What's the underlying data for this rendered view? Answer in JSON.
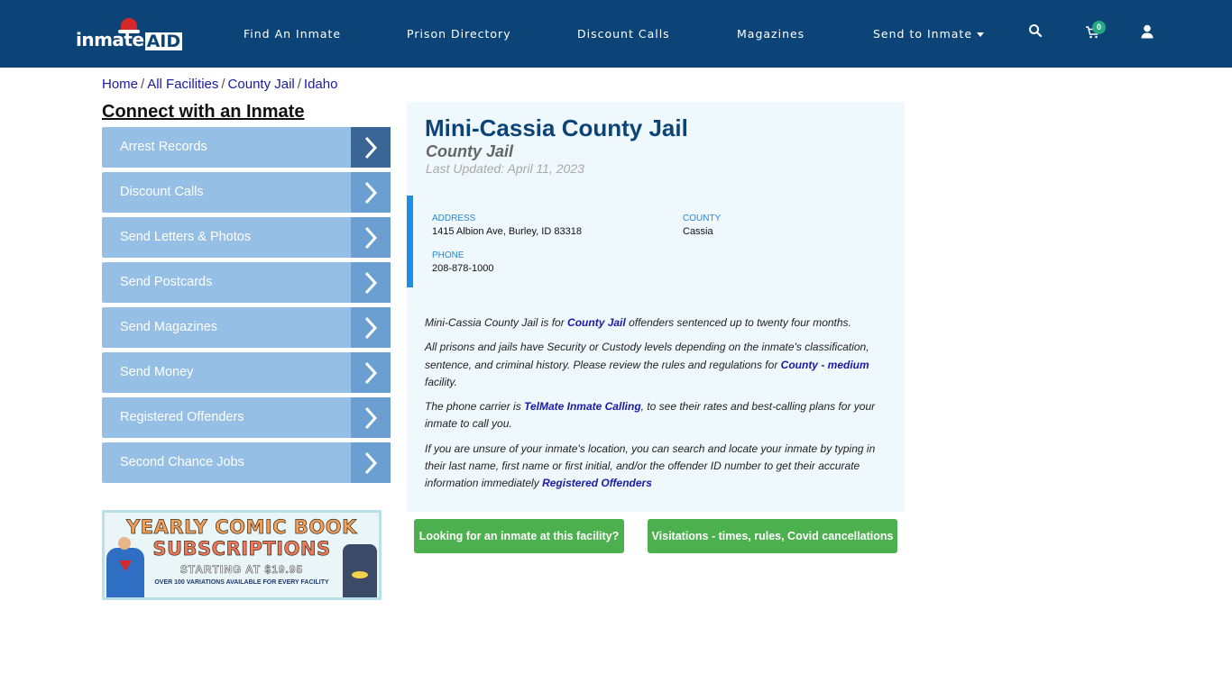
{
  "header": {
    "logo_text_main": "inmate",
    "logo_text_accent": "AID",
    "nav": [
      {
        "label": "Find An Inmate"
      },
      {
        "label": "Prison Directory"
      },
      {
        "label": "Discount Calls"
      },
      {
        "label": "Magazines"
      },
      {
        "label": "Send to Inmate"
      }
    ],
    "icons": [
      "search-icon",
      "cart-icon",
      "user-icon"
    ],
    "cart_count": "0"
  },
  "breadcrumb": [
    {
      "label": "Home"
    },
    {
      "label": "All Facilities"
    },
    {
      "label": "County Jail"
    },
    {
      "label": "Idaho"
    }
  ],
  "sidebar": {
    "title": "Connect with an Inmate",
    "items": [
      {
        "label": "Arrest Records"
      },
      {
        "label": "Discount Calls"
      },
      {
        "label": "Send Letters & Photos"
      },
      {
        "label": "Send Postcards"
      },
      {
        "label": "Send Magazines"
      },
      {
        "label": "Send Money"
      },
      {
        "label": "Registered Offenders"
      },
      {
        "label": "Second Chance Jobs"
      }
    ]
  },
  "ad": {
    "line1": "YEARLY COMIC BOOK",
    "line2": "SUBSCRIPTIONS",
    "line3": "STARTING AT $19.95",
    "line4": "OVER 100 VARIATIONS AVAILABLE FOR EVERY FACILITY"
  },
  "facility": {
    "name": "Mini-Cassia County Jail",
    "type": "County Jail",
    "last_updated": "Last Updated: April 11, 2023",
    "address_label": "ADDRESS",
    "address": "1415 Albion Ave, Burley, ID 83318",
    "county_label": "COUNTY",
    "county": "Cassia",
    "phone_label": "PHONE",
    "phone": "208-878-1000"
  },
  "description": {
    "p1_pre": "Mini-Cassia County Jail is for ",
    "p1_link": "County Jail",
    "p1_post": " offenders sentenced up to twenty four months.",
    "p2_pre": "All prisons and jails have Security or Custody levels depending on the inmate's classification, sentence, and criminal history. Please review the rules and regulations for ",
    "p2_link": "County - medium",
    "p2_post": " facility.",
    "p3_pre": "The phone carrier is ",
    "p3_link": "TelMate Inmate Calling",
    "p3_post": ", to see their rates and best-calling plans for your inmate to call you.",
    "p4_pre": "If you are unsure of your inmate's location, you can search and locate your inmate by typing in their last name, first name or first initial, and/or the offender ID number to get their accurate information immediately ",
    "p4_link": "Registered Offenders"
  },
  "buttons": {
    "find_inmate": "Looking for an inmate at this facility?",
    "visitations": "Visitations - times, rules, Covid cancellations"
  },
  "colors": {
    "header_bg": "#0c4477",
    "sidebar_item": "#96bfe6",
    "sidebar_arrow": "#6b9fd1",
    "accent_blue": "#1a8fe8",
    "button_green": "#4bb04d",
    "link": "#1a1aa6"
  }
}
